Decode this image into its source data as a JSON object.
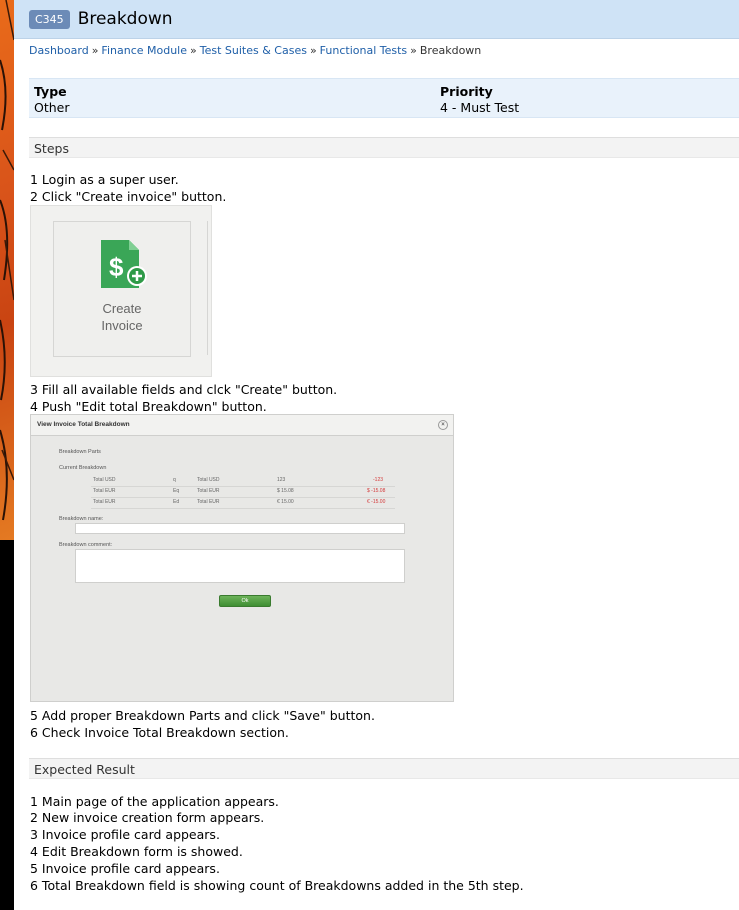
{
  "case": {
    "id": "C345",
    "title": "Breakdown"
  },
  "breadcrumb": [
    "Dashboard",
    "Finance Module",
    "Test Suites & Cases",
    "Functional Tests",
    "Breakdown"
  ],
  "breadcrumb_sep": "»",
  "meta": {
    "type_label": "Type",
    "type_value": "Other",
    "priority_label": "Priority",
    "priority_value": "4 - Must Test"
  },
  "sections": {
    "steps": "Steps",
    "expected": "Expected Result"
  },
  "steps": [
    "1 Login as a super user.",
    "2 Click \"Create invoice\" button.",
    "3 Fill all available fields and clck \"Create\" button.",
    "4 Push \"Edit total Breakdown\" button.",
    "5 Add proper Breakdown Parts and click \"Save\" button.",
    "6 Check Invoice Total Breakdown section."
  ],
  "expected": [
    "1 Main page of the application appears.",
    "2 New invoice creation form appears.",
    "3 Invoice profile card appears.",
    "4 Edit Breakdown form is showed.",
    "5 Invoice profile card appears.",
    "6 Total Breakdown field is showing count of Breakdowns added in the 5th step."
  ],
  "shot1": {
    "label_line1": "Create",
    "label_line2": "Invoice",
    "icon_color": "#3aa657",
    "badge_color": "#2f9a48"
  },
  "shot2": {
    "title": "View Invoice Total Breakdown",
    "parts_label": "Breakdown Parts",
    "current_label": "Current Breakdown",
    "rows": [
      {
        "c1": "Total USD",
        "c2": "q",
        "c3": "Total USD",
        "c4": "123",
        "c5": "-123"
      },
      {
        "c1": "Total EUR",
        "c2": "Eq",
        "c3": "Total EUR",
        "c4": "$ 15.08",
        "c5": "$ -15.08"
      },
      {
        "c1": "Total EUR",
        "c2": "Ed",
        "c3": "Total EUR",
        "c4": "€ 15.00",
        "c5": "€ -15.00"
      }
    ],
    "name_label": "Breakdown name:",
    "comment_label": "Breakdown comment:",
    "ok_label": "Ok"
  }
}
